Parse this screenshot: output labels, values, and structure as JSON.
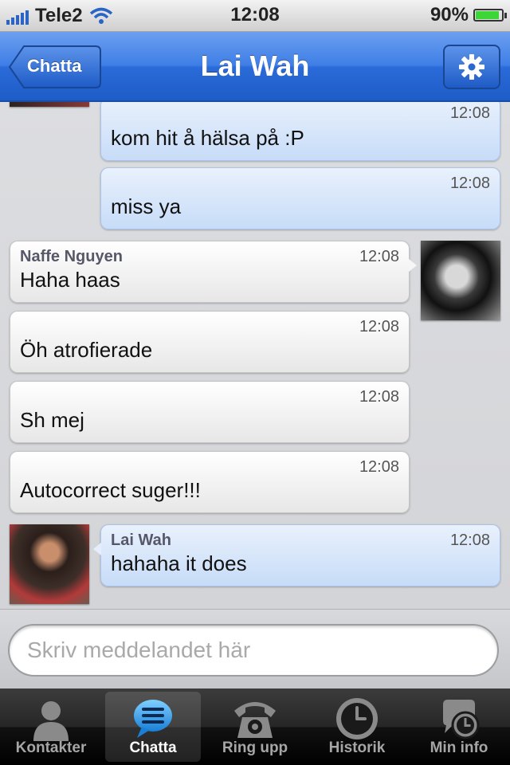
{
  "status_bar": {
    "carrier": "Tele2",
    "time": "12:08",
    "battery": "90%",
    "battery_level": 0.9
  },
  "nav": {
    "back_label": "Chatta",
    "title": "Lai Wah"
  },
  "messages": [
    {
      "time": "12:08",
      "text": "kom hit å hälsa på :P"
    },
    {
      "time": "12:08",
      "text": "miss ya"
    },
    {
      "sender": "Naffe Nguyen",
      "time": "12:08",
      "text": "Haha haas"
    },
    {
      "time": "12:08",
      "text": "Öh atrofierade"
    },
    {
      "time": "12:08",
      "text": "Sh mej"
    },
    {
      "time": "12:08",
      "text": "Autocorrect suger!!!"
    },
    {
      "sender": "Lai Wah",
      "time": "12:08",
      "text": "hahaha it does"
    }
  ],
  "composer": {
    "placeholder": "Skriv meddelandet här"
  },
  "tabs": [
    {
      "label": "Kontakter",
      "icon": "contacts-icon"
    },
    {
      "label": "Chatta",
      "icon": "chat-icon",
      "active": true
    },
    {
      "label": "Ring upp",
      "icon": "phone-icon"
    },
    {
      "label": "Historik",
      "icon": "clock-icon"
    },
    {
      "label": "Min info",
      "icon": "my-info-icon"
    }
  ],
  "colors": {
    "nav_blue": "#2a6bd9",
    "bubble_blue": "#c7dcf8",
    "bubble_grey": "#e7e7e7",
    "tab_active": "#1e88e5"
  }
}
